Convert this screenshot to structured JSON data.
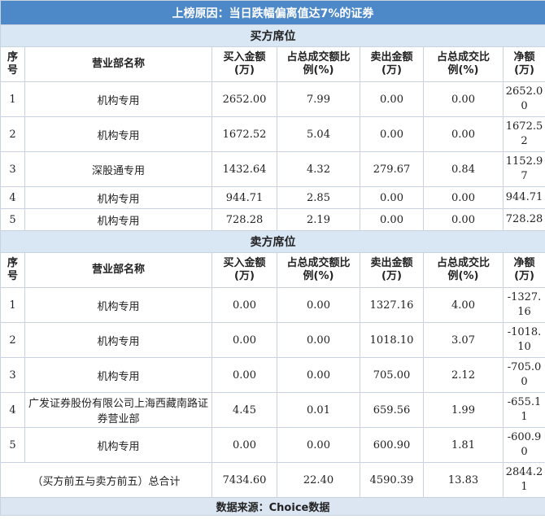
{
  "title": "上榜原因：当日跌幅偏离值达7%的证券",
  "buy_section": {
    "label": "买方席位"
  },
  "sell_section": {
    "label": "卖方席位"
  },
  "columns": [
    "序号",
    "营业部名称",
    "买入金额(万)",
    "占总成交额比例(%)",
    "卖出金额(万)",
    "占总成交比例(%)",
    "净额(万)"
  ],
  "buy_rows": [
    {
      "seq": "1",
      "name": "机构专用",
      "buy": "2652.00",
      "buy_pct": "7.99",
      "sell": "0.00",
      "sell_pct": "0.00",
      "net": "2652.00"
    },
    {
      "seq": "2",
      "name": "机构专用",
      "buy": "1672.52",
      "buy_pct": "5.04",
      "sell": "0.00",
      "sell_pct": "0.00",
      "net": "1672.52"
    },
    {
      "seq": "3",
      "name": "深股通专用",
      "buy": "1432.64",
      "buy_pct": "4.32",
      "sell": "279.67",
      "sell_pct": "0.84",
      "net": "1152.97"
    },
    {
      "seq": "4",
      "name": "机构专用",
      "buy": "944.71",
      "buy_pct": "2.85",
      "sell": "0.00",
      "sell_pct": "0.00",
      "net": "944.71"
    },
    {
      "seq": "5",
      "name": "机构专用",
      "buy": "728.28",
      "buy_pct": "2.19",
      "sell": "0.00",
      "sell_pct": "0.00",
      "net": "728.28"
    }
  ],
  "sell_rows": [
    {
      "seq": "1",
      "name": "机构专用",
      "buy": "0.00",
      "buy_pct": "0.00",
      "sell": "1327.16",
      "sell_pct": "4.00",
      "net": "-1327.16"
    },
    {
      "seq": "2",
      "name": "机构专用",
      "buy": "0.00",
      "buy_pct": "0.00",
      "sell": "1018.10",
      "sell_pct": "3.07",
      "net": "-1018.10"
    },
    {
      "seq": "3",
      "name": "机构专用",
      "buy": "0.00",
      "buy_pct": "0.00",
      "sell": "705.00",
      "sell_pct": "2.12",
      "net": "-705.00"
    },
    {
      "seq": "4",
      "name": "广发证券股份有限公司上海西藏南路证券营业部",
      "buy": "4.45",
      "buy_pct": "0.01",
      "sell": "659.56",
      "sell_pct": "1.99",
      "net": "-655.11"
    },
    {
      "seq": "5",
      "name": "机构专用",
      "buy": "0.00",
      "buy_pct": "0.00",
      "sell": "600.90",
      "sell_pct": "1.81",
      "net": "-600.90"
    }
  ],
  "total": {
    "label": "（买方前五与卖方前五）总合计",
    "buy": "7434.60",
    "buy_pct": "22.40",
    "sell": "4590.39",
    "sell_pct": "13.83",
    "net": "2844.21"
  },
  "footer": "数据来源：Choice数据"
}
